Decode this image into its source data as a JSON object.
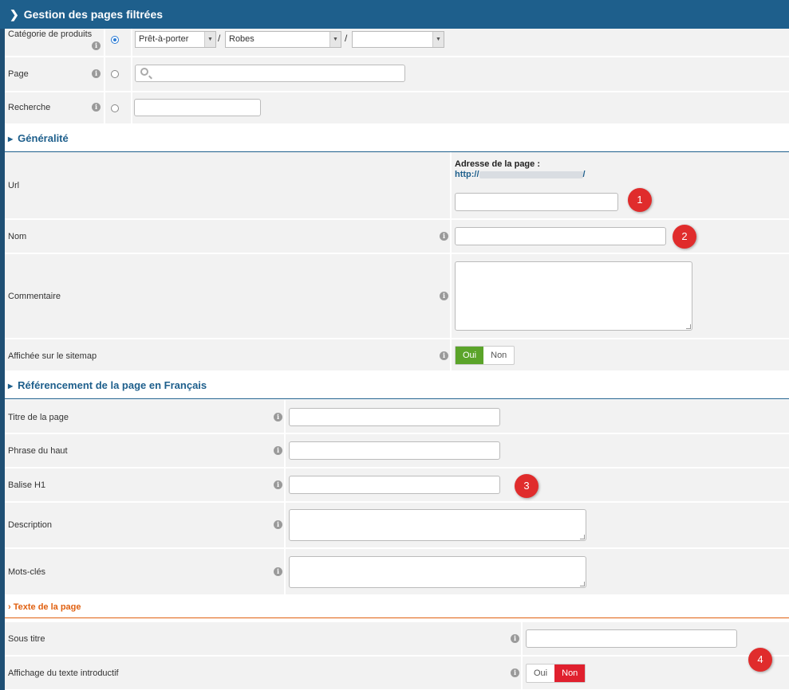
{
  "header": {
    "title": "Gestion des pages filtrées"
  },
  "filters": {
    "category_label": "Catégorie de produits",
    "category_select1": "Prêt-à-porter",
    "category_select2": "Robes",
    "category_select3": "",
    "separator": "/",
    "page_label": "Page",
    "search_label": "Recherche"
  },
  "generalite": {
    "title": "Généralité",
    "url_label": "Url",
    "address_label": "Adresse de la page :",
    "address_prefix": "http://",
    "address_suffix": "/",
    "nom_label": "Nom",
    "commentaire_label": "Commentaire",
    "sitemap_label": "Affichée sur le sitemap",
    "sitemap_yes": "Oui",
    "sitemap_no": "Non"
  },
  "referencement": {
    "title": "Référencement de la page en Français",
    "titre_label": "Titre de la page",
    "phrase_label": "Phrase du haut",
    "h1_label": "Balise H1",
    "description_label": "Description",
    "keywords_label": "Mots-clés"
  },
  "texte": {
    "title": "Texte de la page",
    "sous_titre_label": "Sous titre",
    "affichage_label": "Affichage du texte introductif",
    "affichage_yes": "Oui",
    "affichage_no": "Non"
  },
  "badges": [
    "1",
    "2",
    "3",
    "4"
  ],
  "colors": {
    "header": "#1e5f8c",
    "accent_orange": "#e06010",
    "green": "#5ba42a",
    "red": "#e0202e",
    "badge": "#e02c2c"
  },
  "icons": [
    "chevron-right-icon",
    "info-icon",
    "search-icon",
    "caret-right-icon",
    "caret-down-icon"
  ]
}
